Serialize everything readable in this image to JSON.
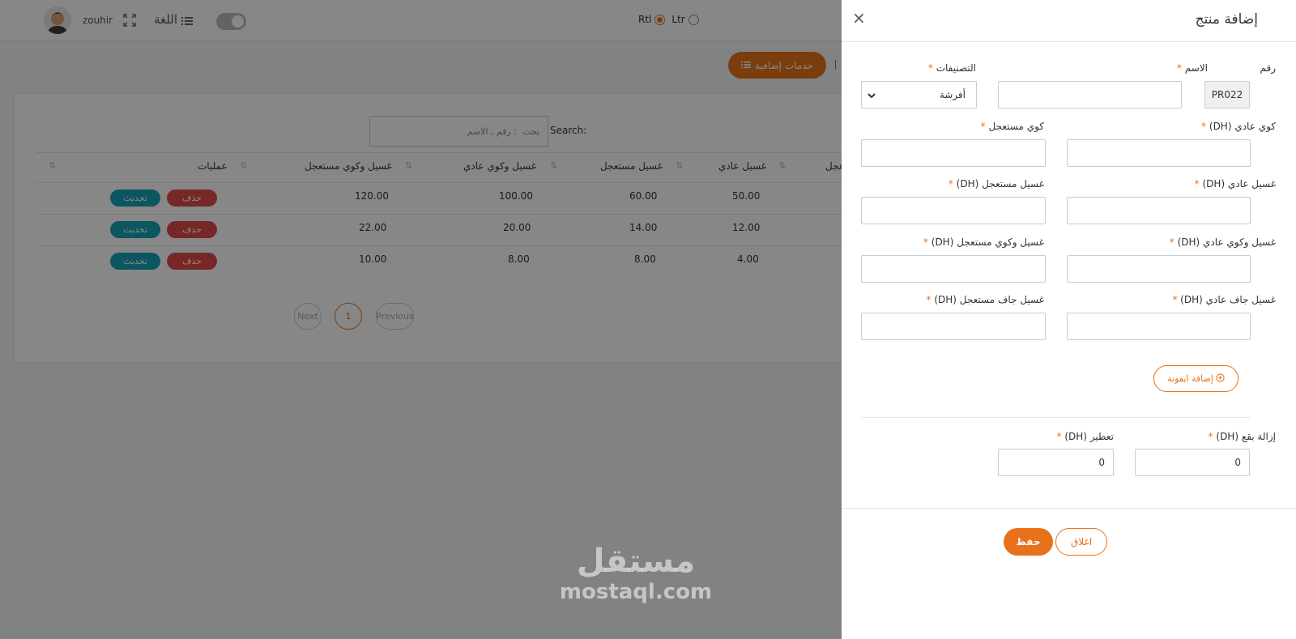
{
  "topbar": {
    "username": "zouhir",
    "language_label": "اللغة",
    "rtl_label": "Rtl",
    "ltr_label": "Ltr"
  },
  "toolbar": {
    "services_button": "خدمات إضافية"
  },
  "table": {
    "search_label": "Search:",
    "search_placeholder": "بحث  : رقم , الاسم",
    "columns": [
      "عمليات",
      "غسيل وكوي مستعجل",
      "غسيل وكوي عادي",
      "غسيل مستعجل",
      "غسيل عادي",
      "عجل"
    ],
    "rows": [
      {
        "col1": "120.00",
        "col2": "100.00",
        "col3": "60.00",
        "col4": "50.00"
      },
      {
        "col1": "22.00",
        "col2": "20.00",
        "col3": "14.00",
        "col4": "12.00"
      },
      {
        "col1": "10.00",
        "col2": "8.00",
        "col3": "8.00",
        "col4": "4.00"
      }
    ],
    "delete_label": "حذف",
    "update_label": "تحديث"
  },
  "pagination": {
    "next": "Next",
    "current": "1",
    "previous": "Previous"
  },
  "watermark": {
    "arabic": "مستقل",
    "latin": "mostaql.com"
  },
  "drawer": {
    "title": "إضافة منتج",
    "close_symbol": "×",
    "required_mark": "*",
    "fields": {
      "number": {
        "label": "رقم",
        "value": "PR022"
      },
      "name": {
        "label": "الاسم",
        "value": ""
      },
      "categories": {
        "label": "التصنيفات",
        "value": "أفرشة"
      },
      "iron_normal": {
        "label": "كوي عادي (DH)",
        "value": ""
      },
      "iron_urgent": {
        "label": "كوي مستعجل",
        "value": ""
      },
      "wash_normal": {
        "label": "غسيل عادي (DH)",
        "value": ""
      },
      "wash_urgent": {
        "label": "غسيل مستعجل (DH)",
        "value": ""
      },
      "wash_iron_normal": {
        "label": "غسيل وكوي عادي (DH)",
        "value": ""
      },
      "wash_iron_urgent": {
        "label": "غسيل وكوي مستعجل (DH)",
        "value": ""
      },
      "dry_normal": {
        "label": "غسيل جاف عادي (DH)",
        "value": ""
      },
      "dry_urgent": {
        "label": "غسيل جاف مستعجل (DH)",
        "value": ""
      },
      "stain_removal": {
        "label": "إزالة بقع (DH)",
        "value": "0"
      },
      "perfume": {
        "label": "تعطير (DH)",
        "value": "0"
      }
    },
    "add_icon_button": "إضافة ايقونة",
    "close_button": "اغلاق",
    "save_button": "حفظ"
  },
  "colors": {
    "accent": "#e8711b",
    "danger": "#e24b4b",
    "info": "#17a2b8"
  }
}
